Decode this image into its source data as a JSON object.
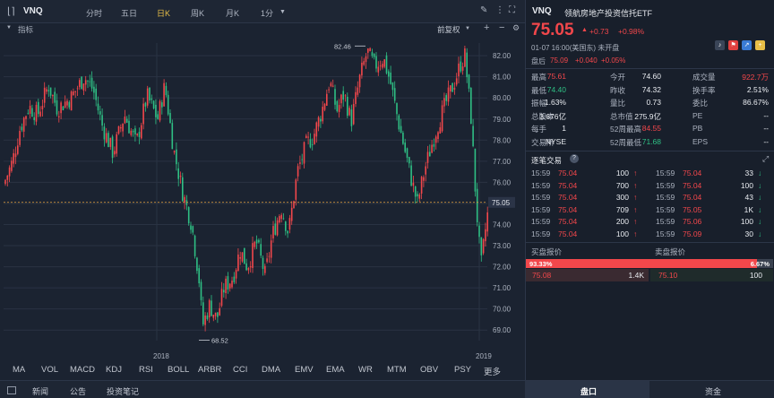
{
  "toolbar": {
    "symbol": "VNQ",
    "tabs": [
      "分时",
      "五日",
      "日K",
      "周K",
      "月K",
      "1分"
    ],
    "active_tab": "日K",
    "indicator_label": "指标",
    "adjust_label": "前复权"
  },
  "chart": {
    "price_ticks": [
      "82.00",
      "81.00",
      "80.00",
      "79.00",
      "78.00",
      "77.00",
      "76.00",
      "75.00",
      "74.00",
      "73.00",
      "72.00",
      "71.00",
      "70.00",
      "69.00"
    ],
    "current_price_tag": "75.05",
    "high_label": "82.46",
    "low_label": "68.52",
    "x_labels": [
      "2018",
      "2019"
    ]
  },
  "chart_data": {
    "type": "candlestick",
    "y_range": [
      68.5,
      82.6
    ],
    "x_labels": [
      "2018",
      "2019"
    ],
    "annotations": [
      {
        "text": "82.46"
      },
      {
        "text": "68.52"
      }
    ],
    "last_price": 75.05
  },
  "indicators": [
    "MA",
    "VOL",
    "MACD",
    "KDJ",
    "RSI",
    "BOLL",
    "ARBR",
    "CCI",
    "DMA",
    "EMV",
    "EMA",
    "WR",
    "MTM",
    "OBV",
    "PSY",
    "更多"
  ],
  "bottom_tabs_left": [
    "新闻",
    "公告",
    "投资笔记"
  ],
  "bottom_tabs_right": [
    "盘口",
    "资金"
  ],
  "quote": {
    "symbol": "VNQ",
    "name": "领航房地产投资信托ETF",
    "price": "75.05",
    "change": "+0.73",
    "change_pct": "+0.98%",
    "time": "01-07  16:00(美国东)  未开盘",
    "after_label": "盘后",
    "after_price": "75.09",
    "after_change": "+0.040",
    "after_pct": "+0.05%",
    "stats": [
      [
        "最高",
        "75.61",
        "今开",
        "74.60",
        "成交量",
        "922.7万"
      ],
      [
        "最低",
        "74.40",
        "昨收",
        "74.32",
        "换手率",
        "2.51%"
      ],
      [
        "振幅",
        "1.63%",
        "量比",
        "0.73",
        "委比",
        "86.67%"
      ],
      [
        "总股本",
        "3.676亿",
        "总市值",
        "275.9亿",
        "PE",
        "--"
      ],
      [
        "每手",
        "1",
        "52周最高",
        "84.55",
        "PB",
        "--"
      ],
      [
        "交易所",
        "NYSE",
        "52周最低",
        "71.68",
        "EPS",
        "--"
      ]
    ]
  },
  "ticks": {
    "title": "逐笔交易",
    "left": [
      [
        "15:59",
        "75.04",
        "100",
        "up"
      ],
      [
        "15:59",
        "75.04",
        "700",
        "up"
      ],
      [
        "15:59",
        "75.04",
        "300",
        "up"
      ],
      [
        "15:59",
        "75.04",
        "709",
        "up"
      ],
      [
        "15:59",
        "75.04",
        "200",
        "up"
      ],
      [
        "15:59",
        "75.04",
        "100",
        "up"
      ]
    ],
    "right": [
      [
        "15:59",
        "75.04",
        "33",
        "down"
      ],
      [
        "15:59",
        "75.04",
        "100",
        "down"
      ],
      [
        "15:59",
        "75.04",
        "43",
        "down"
      ],
      [
        "15:59",
        "75.05",
        "1K",
        "down"
      ],
      [
        "15:59",
        "75.06",
        "100",
        "down"
      ],
      [
        "15:59",
        "75.09",
        "30",
        "down"
      ]
    ]
  },
  "orderbook": {
    "bid_title": "买盘报价",
    "ask_title": "卖盘报价",
    "bid_pct": "93.33%",
    "ask_pct": "6.67%",
    "bid_price": "75.08",
    "bid_size": "1.4K",
    "ask_price": "75.10",
    "ask_size": "100"
  },
  "colors": {
    "up": "#f2474b",
    "down": "#2fbf84",
    "accent": "#e8be47"
  }
}
